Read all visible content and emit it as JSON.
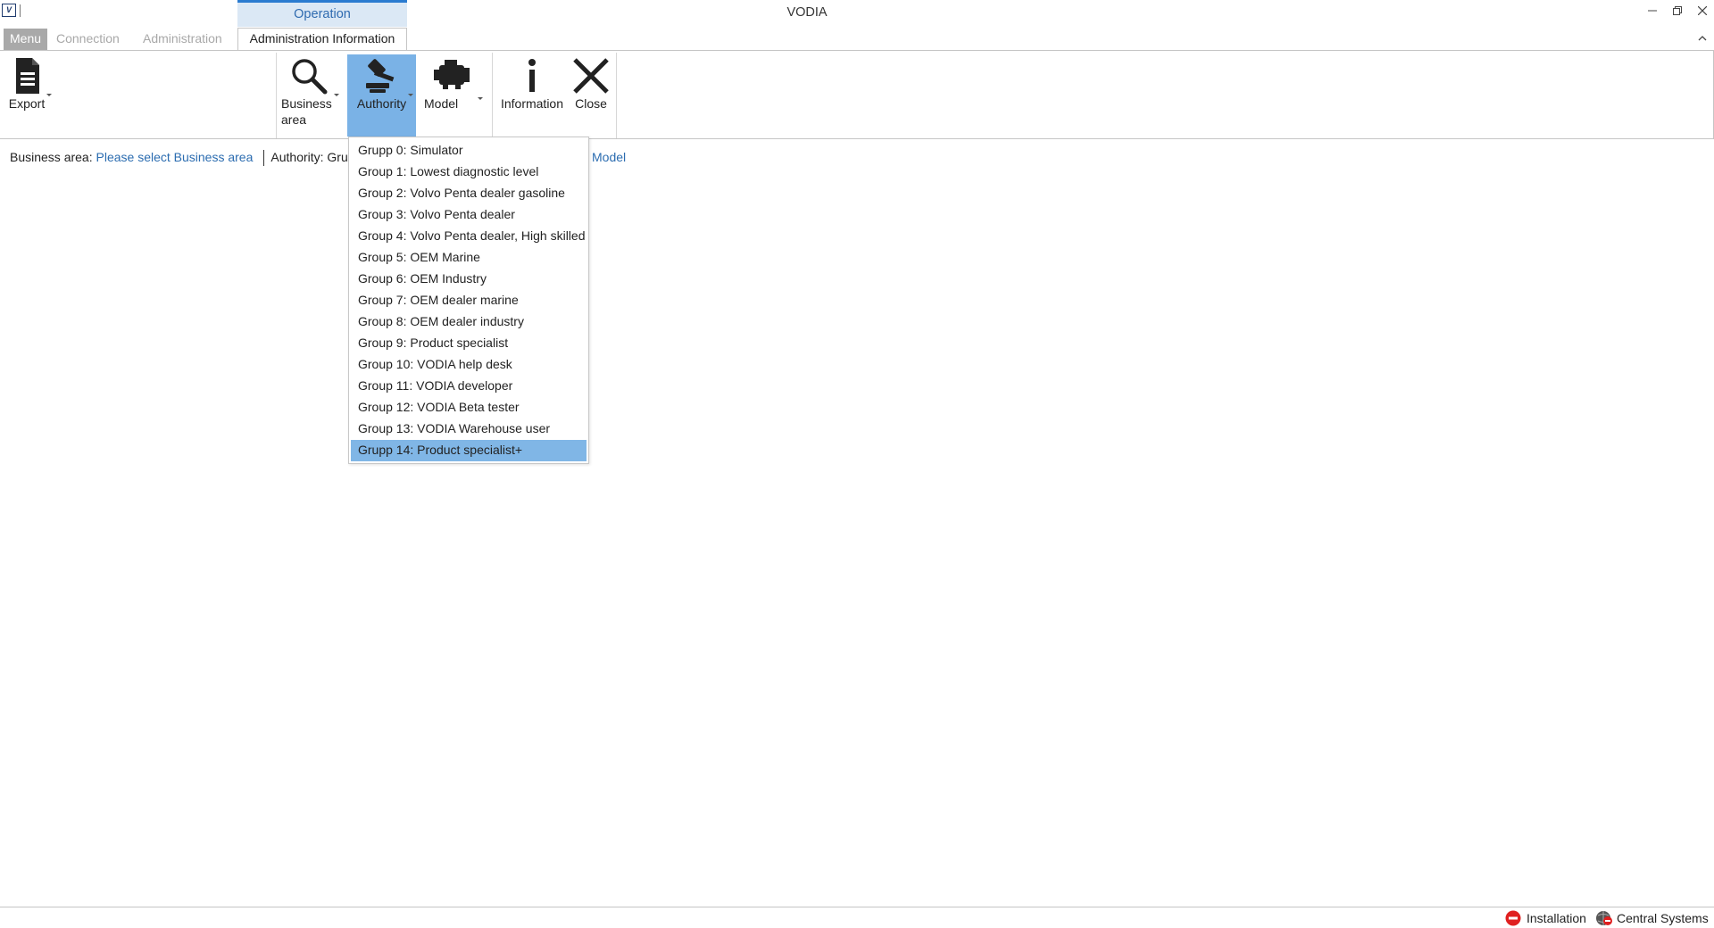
{
  "window": {
    "title": "VODIA",
    "app_icon_text": "V",
    "contextual_tab_header": "Operation"
  },
  "tabs": [
    {
      "label": "Menu"
    },
    {
      "label": "Connection"
    },
    {
      "label": "Administration"
    },
    {
      "label": "Administration Information"
    }
  ],
  "ribbon": {
    "export_label": "Export",
    "business_area_label": "Business area",
    "authority_label": "Authority",
    "model_label": "Model",
    "information_label": "Information",
    "close_label": "Close"
  },
  "info": {
    "business_area_key": "Business area:",
    "business_area_value": "Please select Business area",
    "authority_key": "Authority:",
    "authority_value": "Grupp 1",
    "model_link": "Model"
  },
  "authority_dropdown": {
    "selected_index": 14,
    "items": [
      "Grupp 0: Simulator",
      "Group 1: Lowest diagnostic level",
      "Group 2: Volvo Penta dealer gasoline",
      "Group 3: Volvo Penta dealer",
      "Group 4: Volvo Penta dealer, High skilled",
      "Group 5: OEM Marine",
      "Group 6: OEM Industry",
      "Group 7: OEM dealer marine",
      "Group 8: OEM dealer industry",
      "Group 9: Product specialist",
      "Group 10: VODIA help desk",
      "Group 11: VODIA developer",
      "Group 12: VODIA Beta tester",
      "Group 13: VODIA Warehouse user",
      "Grupp 14: Product specialist+"
    ]
  },
  "status": {
    "installation_label": "Installation",
    "central_systems_label": "Central Systems"
  },
  "colors": {
    "accent": "#2a7bd0",
    "selected_bg": "#80b6e6",
    "link": "#2b6cb0",
    "error_red": "#e02020"
  }
}
